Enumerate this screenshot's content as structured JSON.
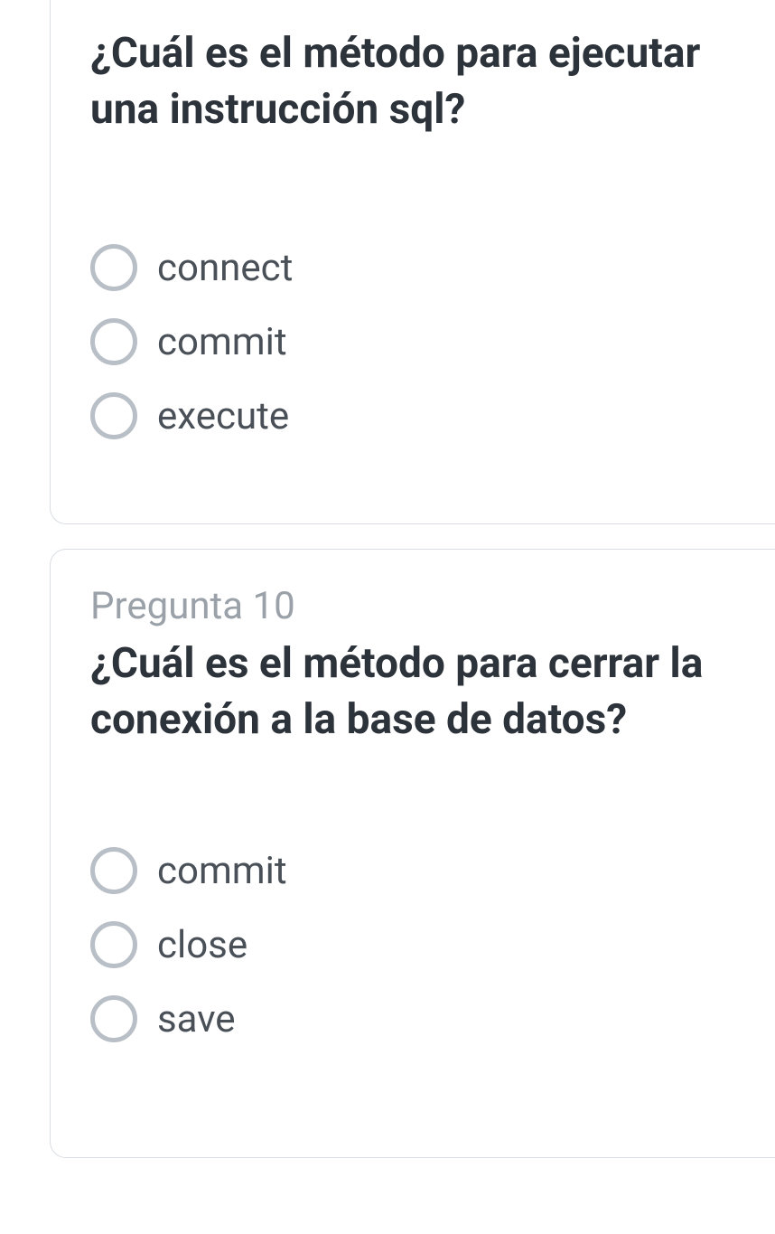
{
  "questions": [
    {
      "number": "",
      "text": "¿Cuál es el método para ejecutar una instrucción sql?",
      "options": [
        "connect",
        "commit",
        "execute"
      ]
    },
    {
      "number": "Pregunta 10",
      "text": "¿Cuál es el método para cerrar la conexión a la base de datos?",
      "options": [
        "commit",
        "close",
        "save"
      ]
    }
  ]
}
